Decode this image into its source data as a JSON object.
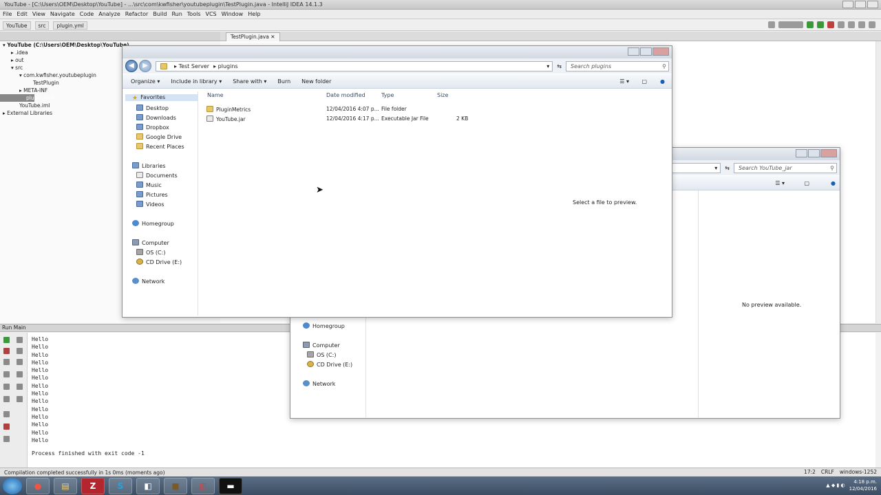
{
  "ide": {
    "window_title": "YouTube - [C:\\Users\\OEM\\Desktop\\YouTube] - ...\\src\\com\\kwfisher\\youtubeplugin\\TestPlugin.java - IntelliJ IDEA 14.1.3",
    "menu": [
      "File",
      "Edit",
      "View",
      "Navigate",
      "Code",
      "Analyze",
      "Refactor",
      "Build",
      "Run",
      "Tools",
      "VCS",
      "Window",
      "Help"
    ],
    "breadcrumbs": [
      "YouTube",
      "src",
      "plugin.yml"
    ],
    "editor_tab": "TestPlugin.java",
    "tree": [
      {
        "label": "YouTube (C:\\Users\\OEM\\Desktop\\YouTube)",
        "level": 0
      },
      {
        "label": ".idea",
        "level": 1
      },
      {
        "label": "out",
        "level": 1
      },
      {
        "label": "src",
        "level": 1
      },
      {
        "label": "com.kwfisher.youtubeplugin",
        "level": 2
      },
      {
        "label": "TestPlugin",
        "level": 3
      },
      {
        "label": "META-INF",
        "level": 2
      },
      {
        "label": "plugin.yml",
        "level": 2,
        "selected": true
      },
      {
        "label": "YouTube.iml",
        "level": 1
      },
      {
        "label": "External Libraries",
        "level": 0
      }
    ],
    "run_panel_title": "Run  Main",
    "console_lines": [
      "Hello",
      "Hello",
      "Hello",
      "Hello",
      "Hello",
      "Hello",
      "Hello",
      "Hello",
      "Hello",
      "Hello",
      "Hello",
      "Hello",
      "Hello",
      "Hello"
    ],
    "console_exit": "Process finished with exit code -1",
    "status_left": "Compilation completed successfully in 1s 0ms (moments ago)",
    "status_right": [
      "17:2",
      "CRLF",
      "windows-1252"
    ]
  },
  "explorer_front": {
    "path": [
      "Test Server",
      "plugins"
    ],
    "search_placeholder": "Search plugins",
    "toolbar": [
      "Organize",
      "Include in library",
      "Share with",
      "Burn",
      "New folder"
    ],
    "nav": {
      "favorites": "Favorites",
      "favorite_items": [
        "Desktop",
        "Downloads",
        "Dropbox",
        "Google Drive",
        "Recent Places"
      ],
      "libraries": "Libraries",
      "library_items": [
        "Documents",
        "Music",
        "Pictures",
        "Videos"
      ],
      "homegroup": "Homegroup",
      "computer": "Computer",
      "computer_items": [
        "OS (C:)",
        "CD Drive (E:)"
      ],
      "network": "Network"
    },
    "columns": [
      "Name",
      "Date modified",
      "Type",
      "Size"
    ],
    "files": [
      {
        "name": "PluginMetrics",
        "date": "12/04/2016 4:07 p...",
        "type": "File folder",
        "size": ""
      },
      {
        "name": "YouTube.jar",
        "date": "12/04/2016 4:17 p...",
        "type": "Executable Jar File",
        "size": "2 KB"
      }
    ]
  },
  "explorer_back": {
    "search_placeholder": "Search YouTube_jar",
    "nav": {
      "homegroup": "Homegroup",
      "computer": "Computer",
      "computer_items": [
        "OS (C:)",
        "CD Drive (E:)"
      ],
      "network": "Network"
    },
    "preview_select": "Select a file to preview.",
    "preview_none": "No preview available."
  },
  "taskbar": {
    "clock_time": "4:18 p.m.",
    "clock_date": "12/04/2016"
  }
}
